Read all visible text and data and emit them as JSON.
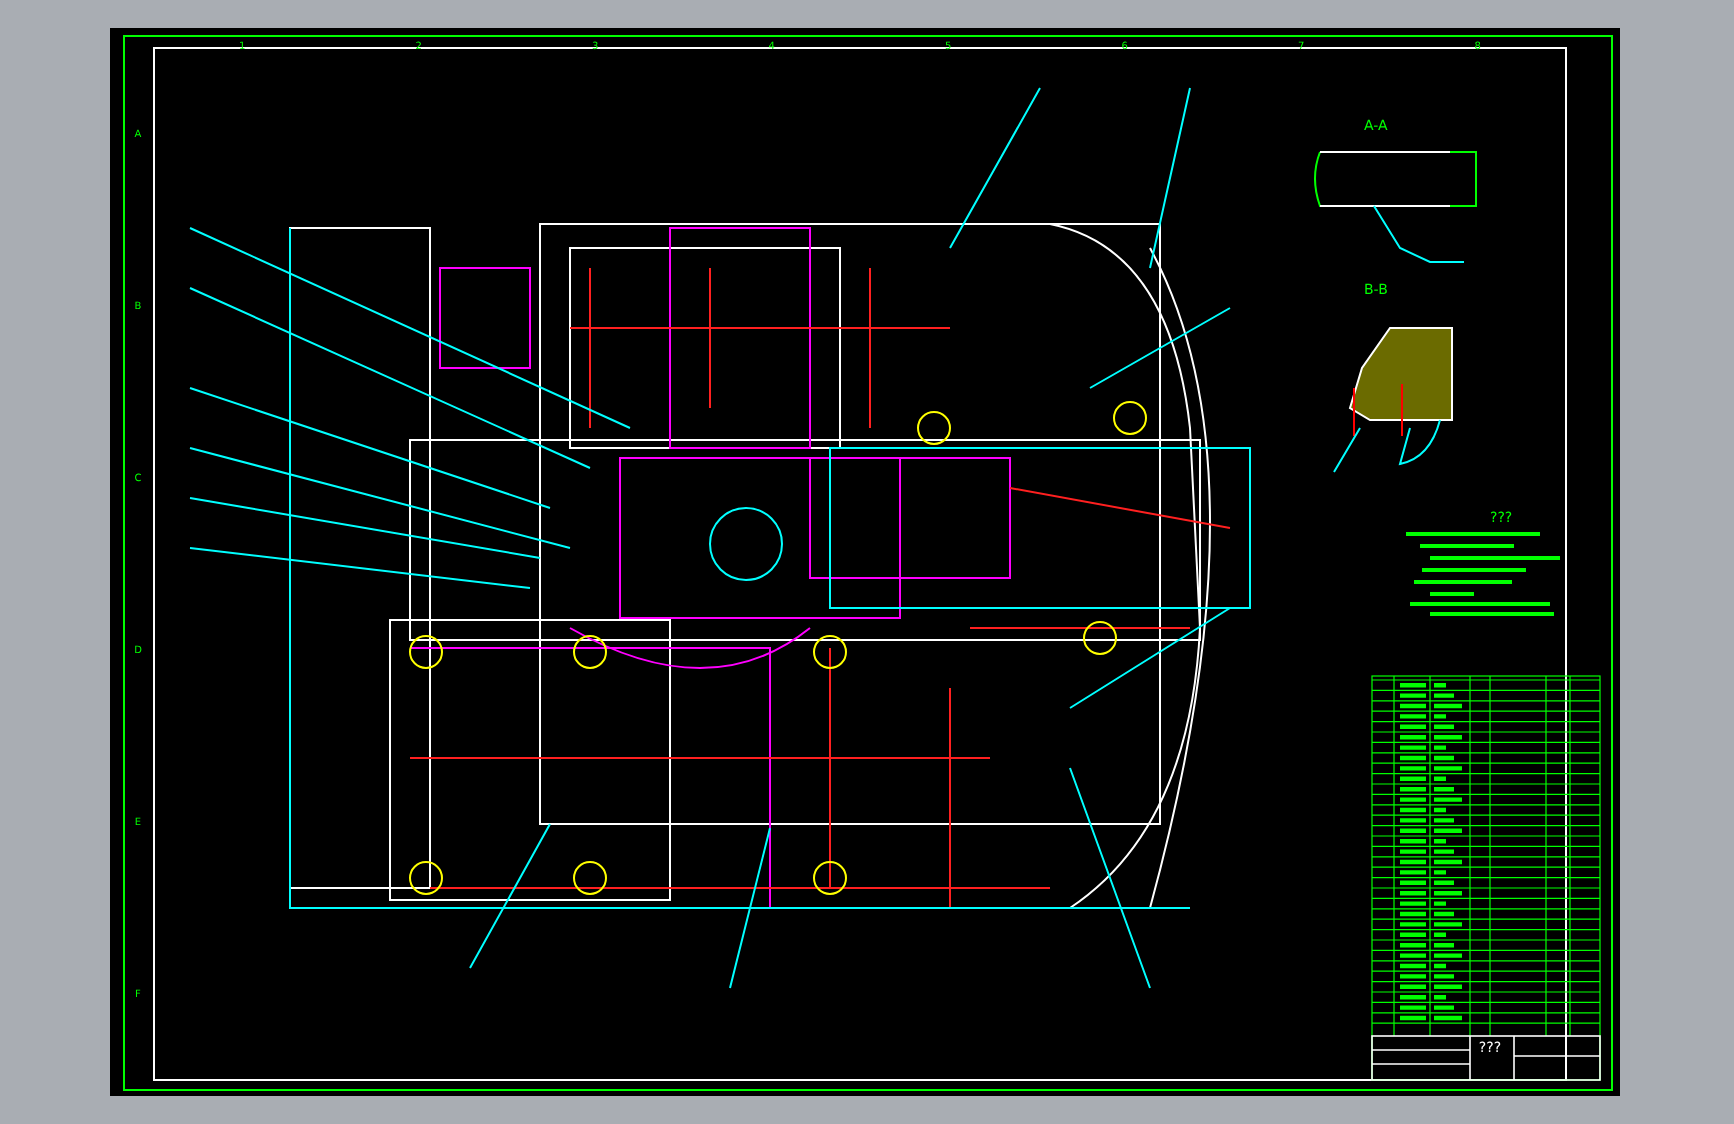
{
  "zone_columns": [
    "1",
    "2",
    "3",
    "4",
    "5",
    "6",
    "7",
    "8"
  ],
  "zone_rows": [
    "A",
    "B",
    "C",
    "D",
    "E",
    "F"
  ],
  "section_views": [
    {
      "label": "A-A"
    },
    {
      "label": "B-B"
    }
  ],
  "notes": {
    "title": "???"
  },
  "title_block": {
    "name": "???"
  }
}
